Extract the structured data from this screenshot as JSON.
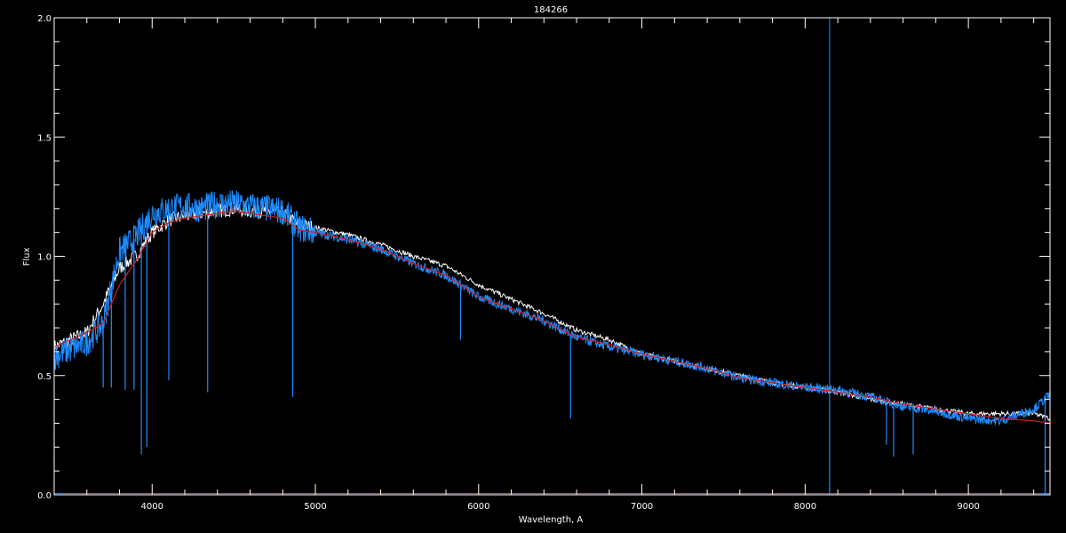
{
  "chart_data": {
    "type": "line",
    "title": "184266",
    "xlabel": "Wavelength, A",
    "ylabel": "Flux",
    "xlim": [
      3400,
      9500
    ],
    "ylim": [
      0.0,
      2.0
    ],
    "x_ticks": [
      4000,
      5000,
      6000,
      7000,
      8000,
      9000
    ],
    "x_tick_labels": [
      "4000",
      "5000",
      "6000",
      "7000",
      "8000",
      "9000"
    ],
    "y_ticks": [
      0.0,
      0.5,
      1.0,
      1.5,
      2.0
    ],
    "y_tick_labels": [
      "0.0",
      "0.5",
      "1.0",
      "1.5",
      "2.0"
    ],
    "grid": false,
    "colors": {
      "background": "#000000",
      "axes": "#ffffff",
      "white_series": "#ffffff",
      "blue_series": "#1e8cff",
      "red_series": "#d21e1e"
    },
    "series": [
      {
        "color": "#ffffff",
        "x": [
          3400,
          3600,
          3700,
          3800,
          3900,
          4000,
          4100,
          4200,
          4300,
          4400,
          4500,
          4600,
          4700,
          4800,
          4900,
          5000,
          5200,
          5400,
          5600,
          5800,
          6000,
          6200,
          6400,
          6600,
          6800,
          7000,
          7200,
          7400,
          7600,
          7800,
          8000,
          8200,
          8400,
          8600,
          8800,
          9000,
          9200,
          9400,
          9500
        ],
        "y": [
          0.62,
          0.68,
          0.8,
          0.95,
          1.0,
          1.1,
          1.15,
          1.17,
          1.18,
          1.19,
          1.2,
          1.19,
          1.19,
          1.18,
          1.13,
          1.12,
          1.09,
          1.05,
          1.0,
          0.96,
          0.88,
          0.82,
          0.76,
          0.69,
          0.65,
          0.59,
          0.56,
          0.53,
          0.5,
          0.47,
          0.45,
          0.43,
          0.4,
          0.38,
          0.36,
          0.34,
          0.34,
          0.34,
          0.32
        ]
      },
      {
        "color": "#1e8cff",
        "x": [
          3400,
          3600,
          3700,
          3800,
          3900,
          4000,
          4100,
          4200,
          4300,
          4400,
          4500,
          4600,
          4700,
          4800,
          4900,
          5000,
          5200,
          5400,
          5600,
          5800,
          6000,
          6200,
          6400,
          6600,
          6800,
          7000,
          7200,
          7400,
          7600,
          7800,
          8000,
          8200,
          8400,
          8600,
          8800,
          9000,
          9200,
          9400,
          9500
        ],
        "y": [
          0.58,
          0.64,
          0.72,
          1.02,
          1.08,
          1.18,
          1.2,
          1.21,
          1.2,
          1.22,
          1.22,
          1.21,
          1.2,
          1.19,
          1.12,
          1.1,
          1.07,
          1.03,
          0.97,
          0.92,
          0.83,
          0.78,
          0.73,
          0.66,
          0.62,
          0.59,
          0.56,
          0.53,
          0.49,
          0.47,
          0.45,
          0.44,
          0.41,
          0.37,
          0.35,
          0.32,
          0.31,
          0.36,
          0.42
        ]
      },
      {
        "color": "#d21e1e",
        "x": [
          3400,
          3600,
          3700,
          3800,
          3900,
          4000,
          4100,
          4200,
          4300,
          4400,
          4500,
          4600,
          4700,
          4800,
          4900,
          5000,
          5200,
          5400,
          5600,
          5800,
          6000,
          6200,
          6400,
          6600,
          6800,
          7000,
          7200,
          7400,
          7600,
          7800,
          8000,
          8200,
          8400,
          8600,
          8800,
          9000,
          9200,
          9400,
          9500
        ],
        "y": [
          0.62,
          0.68,
          0.72,
          0.88,
          0.98,
          1.1,
          1.14,
          1.16,
          1.17,
          1.18,
          1.19,
          1.18,
          1.17,
          1.16,
          1.11,
          1.1,
          1.07,
          1.03,
          0.97,
          0.92,
          0.83,
          0.78,
          0.73,
          0.66,
          0.63,
          0.59,
          0.56,
          0.53,
          0.49,
          0.47,
          0.45,
          0.43,
          0.41,
          0.38,
          0.36,
          0.34,
          0.32,
          0.31,
          0.3
        ]
      }
    ],
    "blue_absorption_lines": [
      {
        "x": 3700,
        "y": 0.45
      },
      {
        "x": 3750,
        "y": 0.45
      },
      {
        "x": 3835,
        "y": 0.44
      },
      {
        "x": 3889,
        "y": 0.44
      },
      {
        "x": 3934,
        "y": 0.17
      },
      {
        "x": 3968,
        "y": 0.2
      },
      {
        "x": 4102,
        "y": 0.48
      },
      {
        "x": 4340,
        "y": 0.43
      },
      {
        "x": 4861,
        "y": 0.41
      },
      {
        "x": 5889,
        "y": 0.65
      },
      {
        "x": 6563,
        "y": 0.32
      },
      {
        "x": 8150,
        "y": 0.0
      },
      {
        "x": 8498,
        "y": 0.21
      },
      {
        "x": 8542,
        "y": 0.16
      },
      {
        "x": 8662,
        "y": 0.17
      },
      {
        "x": 9470,
        "y": 0.0
      }
    ],
    "blue_spike": {
      "x": 8150,
      "y": 2.0
    },
    "blue_baseline": {
      "x": [
        3400,
        9500
      ],
      "y": 0.005
    }
  }
}
